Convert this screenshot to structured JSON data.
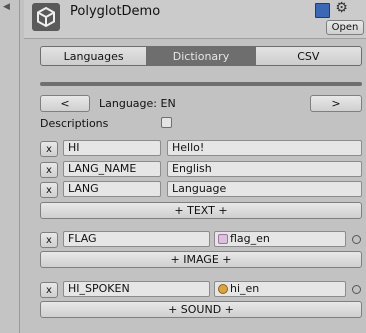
{
  "window": {
    "title": "PolyglotDemo",
    "open_label": "Open",
    "settings_icon": "gear-icon",
    "help_icon": "book-icon"
  },
  "tabs": [
    {
      "label": "Languages",
      "active": false
    },
    {
      "label": "Dictionary",
      "active": true
    },
    {
      "label": "CSV",
      "active": false
    }
  ],
  "nav": {
    "prev_label": "<",
    "next_label": ">",
    "language_label": "Language: EN"
  },
  "descriptions": {
    "label": "Descriptions",
    "checked": false
  },
  "text_entries": [
    {
      "key": "HI",
      "value": "Hello!"
    },
    {
      "key": "LANG_NAME",
      "value": "English"
    },
    {
      "key": "LANG",
      "value": "Language"
    }
  ],
  "remove_label": "x",
  "add_text_label": "+ TEXT +",
  "image_entries": [
    {
      "key": "FLAG",
      "value": "flag_en"
    }
  ],
  "add_image_label": "+ IMAGE +",
  "sound_entries": [
    {
      "key": "HI_SPOKEN",
      "value": "hi_en"
    }
  ],
  "add_sound_label": "+ SOUND +"
}
